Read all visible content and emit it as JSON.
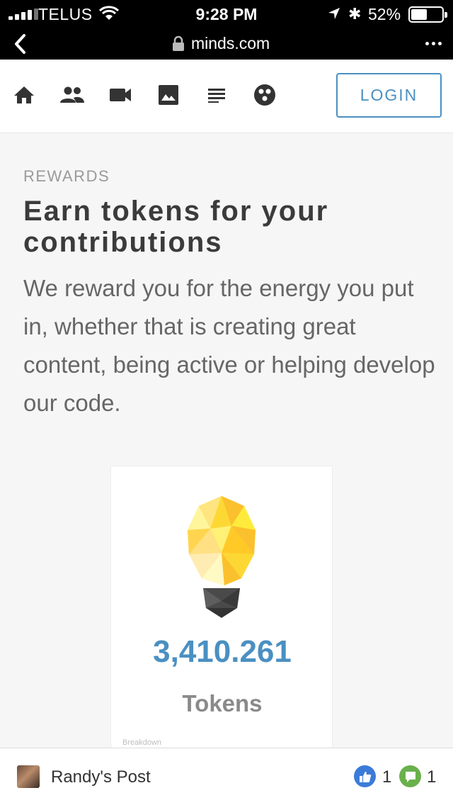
{
  "status_bar": {
    "carrier": "TELUS",
    "time": "9:28 PM",
    "battery_percent": "52%",
    "battery_level": 0.52
  },
  "browser": {
    "domain": "minds.com"
  },
  "nav": {
    "icons": [
      "home-icon",
      "groups-icon",
      "video-icon",
      "images-icon",
      "blogs-icon",
      "discovery-icon"
    ],
    "login_label": "LOGIN"
  },
  "rewards": {
    "eyebrow": "REWARDS",
    "headline": "Earn tokens for your contributions",
    "body": "We reward you for the energy you put in, whether that is creating great content, being active or helping develop our code."
  },
  "token_card": {
    "count": "3,410.261",
    "label": "Tokens",
    "breakdown": "Breakdown"
  },
  "bottom_bar": {
    "post_title": "Randy's Post",
    "like_count": "1",
    "comment_count": "1"
  },
  "colors": {
    "accent": "#4a90c2",
    "bulb_yellow": "#fdd835",
    "like_blue": "#3b7bd8",
    "comment_green": "#6ab04c"
  }
}
